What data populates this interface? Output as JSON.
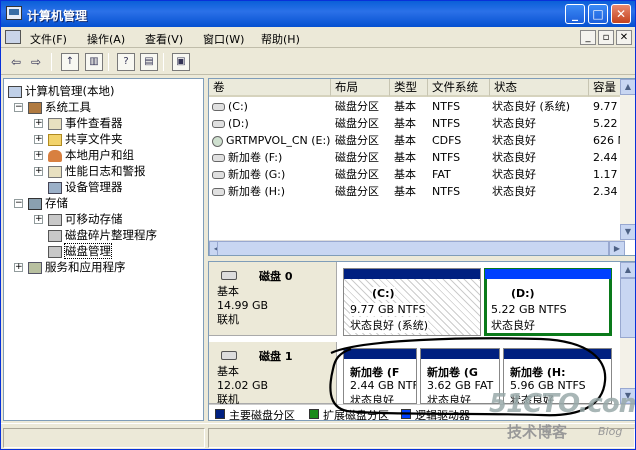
{
  "window": {
    "title": "计算机管理",
    "min": "_",
    "max": "□",
    "close": "✕"
  },
  "menubar": {
    "items": [
      {
        "label": "文件(F)"
      },
      {
        "label": "操作(A)"
      },
      {
        "label": "查看(V)"
      },
      {
        "label": "窗口(W)"
      },
      {
        "label": "帮助(H)"
      }
    ],
    "mdi": {
      "min": "_",
      "restore": "▫",
      "close": "✕"
    }
  },
  "toolbar": {
    "back": "⇦",
    "forward": "⇨"
  },
  "tree": {
    "root": "计算机管理(本地)",
    "system_tools": "系统工具",
    "event_viewer": "事件查看器",
    "shared_folders": "共享文件夹",
    "local_users": "本地用户和组",
    "perf_logs": "性能日志和警报",
    "device_manager": "设备管理器",
    "storage": "存储",
    "removable": "可移动存储",
    "defrag": "磁盘碎片整理程序",
    "disk_mgmt": "磁盘管理",
    "services_apps": "服务和应用程序",
    "expand": "+",
    "collapse": "−"
  },
  "volume_list": {
    "columns": [
      "卷",
      "布局",
      "类型",
      "文件系统",
      "状态",
      "容量"
    ],
    "rows": [
      {
        "vol": "(C:)",
        "layout": "磁盘分区",
        "type": "基本",
        "fs": "NTFS",
        "status": "状态良好 (系统)",
        "cap": "9.77 GB",
        "icon": "drive-icon"
      },
      {
        "vol": "(D:)",
        "layout": "磁盘分区",
        "type": "基本",
        "fs": "NTFS",
        "status": "状态良好",
        "cap": "5.22 GB",
        "icon": "drive-icon"
      },
      {
        "vol": "GRTMPVOL_CN (E:)",
        "layout": "磁盘分区",
        "type": "基本",
        "fs": "CDFS",
        "status": "状态良好",
        "cap": "626 MB",
        "icon": "cd-icon"
      },
      {
        "vol": "新加卷 (F:)",
        "layout": "磁盘分区",
        "type": "基本",
        "fs": "NTFS",
        "status": "状态良好",
        "cap": "2.44 GB",
        "icon": "drive-icon"
      },
      {
        "vol": "新加卷 (G:)",
        "layout": "磁盘分区",
        "type": "基本",
        "fs": "FAT",
        "status": "状态良好",
        "cap": "1.17 GB",
        "icon": "drive-icon"
      },
      {
        "vol": "新加卷 (H:)",
        "layout": "磁盘分区",
        "type": "基本",
        "fs": "NTFS",
        "status": "状态良好",
        "cap": "2.34 GB",
        "icon": "drive-icon"
      }
    ]
  },
  "disks": {
    "disk0": {
      "name": "磁盘 0",
      "type": "基本",
      "size": "14.99 GB",
      "state": "联机",
      "partitions": [
        {
          "title": "(C:)",
          "line1": "9.77 GB NTFS",
          "line2": "状态良好 (系统)"
        },
        {
          "title": "(D:)",
          "line1": "5.22 GB NTFS",
          "line2": "状态良好"
        }
      ]
    },
    "disk1": {
      "name": "磁盘 1",
      "type": "基本",
      "size": "12.02 GB",
      "state": "联机",
      "partitions": [
        {
          "title": "新加卷 (F",
          "line1": "2.44 GB NTF",
          "line2": "状态良好"
        },
        {
          "title": "新加卷 (G",
          "line1": "3.62 GB FAT",
          "line2": "状态良好"
        },
        {
          "title": "新加卷 (H:",
          "line1": "5.96 GB NTFS",
          "line2": "状态良好"
        }
      ]
    }
  },
  "legend": {
    "primary": "主要磁盘分区",
    "primary_color": "#002080",
    "extended": "扩展磁盘分区",
    "extended_color": "#1a8a1a",
    "logical": "逻辑驱动器",
    "logical_color": "#0040ff"
  },
  "watermark": {
    "site": "51CTO.com",
    "sub": "技术博客",
    "blog": "Blog"
  },
  "colors": {
    "selected_outline": "#0a7a1a",
    "titlebar": "#0a5fd8"
  }
}
